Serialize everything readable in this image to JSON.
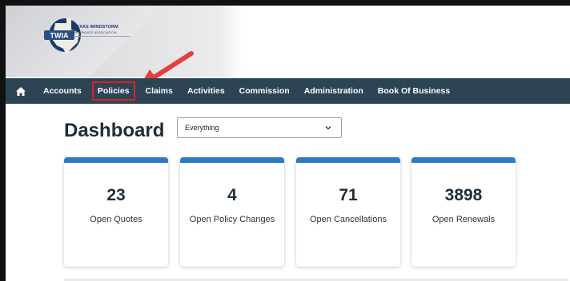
{
  "logo": {
    "mark": "TWIA",
    "name_line1": "TEXAS WINDSTORM",
    "name_line2": "INSURANCE ASSOCIATION"
  },
  "nav": {
    "home_icon": "home-icon",
    "items": [
      {
        "label": "Accounts"
      },
      {
        "label": "Policies",
        "highlighted": true
      },
      {
        "label": "Claims"
      },
      {
        "label": "Activities"
      },
      {
        "label": "Commission"
      },
      {
        "label": "Administration"
      },
      {
        "label": "Book Of Business"
      }
    ]
  },
  "dashboard": {
    "title": "Dashboard",
    "filter_value": "Everything"
  },
  "cards": [
    {
      "value": "23",
      "label": "Open Quotes"
    },
    {
      "value": "4",
      "label": "Open Policy Changes"
    },
    {
      "value": "71",
      "label": "Open Cancellations"
    },
    {
      "value": "3898",
      "label": "Open Renewals"
    }
  ],
  "colors": {
    "navbar": "#2d4455",
    "card_accent": "#2f79c6",
    "annotation": "#e02020"
  }
}
